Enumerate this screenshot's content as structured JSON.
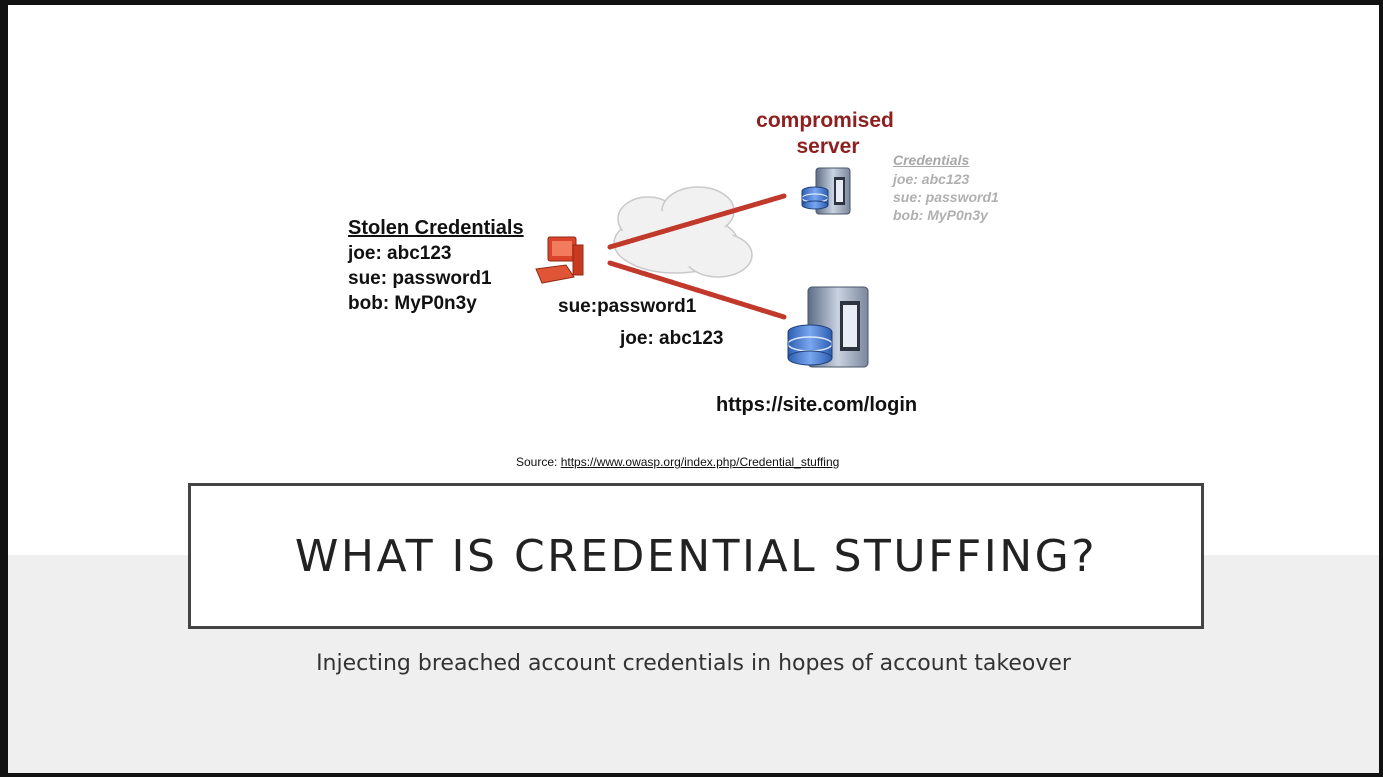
{
  "diagram": {
    "stolen": {
      "title": "Stolen Credentials",
      "lines": [
        "joe: abc123",
        "sue: password1",
        "bob: MyP0n3y"
      ]
    },
    "compromised": {
      "line1": "compromised",
      "line2": "server"
    },
    "credentials": {
      "title": "Credentials",
      "lines": [
        "joe: abc123",
        "sue: password1",
        "bob: MyP0n3y"
      ]
    },
    "sent": [
      "sue:password1",
      "joe: abc123"
    ],
    "target_url": "https://site.com/login",
    "colors": {
      "attack_line": "#c0392b",
      "compromised_label": "#8e1f1f",
      "server_blue": "#3a6fc4"
    }
  },
  "source": {
    "label": "Source: ",
    "link": "https://www.owasp.org/index.php/Credential_stuffing"
  },
  "slide": {
    "title": "WHAT IS CREDENTIAL STUFFING?",
    "subtitle": "Injecting breached account credentials in hopes of account takeover"
  }
}
